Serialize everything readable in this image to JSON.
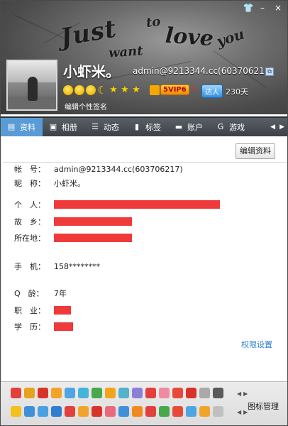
{
  "window": {
    "controls": {
      "skin_icon": "👕",
      "minimize": "–",
      "close": "×"
    }
  },
  "banner": {
    "script_words": [
      "Just",
      "to",
      "love",
      "you",
      "want"
    ]
  },
  "profile": {
    "nickname": "小虾米。",
    "account": "admin@9213344.cc(603706217)",
    "vip_label": "5VIP6",
    "vip_up": "↑",
    "daren_label": "达人",
    "days": "230天",
    "signature": "编辑个性签名",
    "level_icons": [
      "sun-icon",
      "sun-icon",
      "sun-icon",
      "moon-icon",
      "star-icon",
      "star-icon",
      "star-icon"
    ]
  },
  "tabs": [
    {
      "label": "资料",
      "icon": "profile-card-icon",
      "glyph": "▤",
      "active": true
    },
    {
      "label": "相册",
      "icon": "photo-icon",
      "glyph": "▣",
      "active": false
    },
    {
      "label": "动态",
      "icon": "feed-icon",
      "glyph": "☰",
      "active": false
    },
    {
      "label": "标签",
      "icon": "bookmark-icon",
      "glyph": "▮",
      "active": false
    },
    {
      "label": "账户",
      "icon": "wallet-icon",
      "glyph": "▬",
      "active": false
    },
    {
      "label": "游戏",
      "icon": "game-icon",
      "glyph": "G",
      "active": false
    }
  ],
  "tab_arrows": {
    "left": "◀",
    "right": "▶"
  },
  "content": {
    "edit_button": "编辑资料",
    "fields": {
      "account": {
        "label": "帐　号：",
        "value": "admin@9213344.cc(603706217)"
      },
      "nickname": {
        "label": "昵　称：",
        "value": "小虾米。"
      },
      "personal": {
        "label": "个　人："
      },
      "hometown": {
        "label": "故　乡："
      },
      "location": {
        "label": "所在地："
      },
      "phone": {
        "label": "手　机：",
        "value": "158********"
      },
      "qage": {
        "label": "Q　龄：",
        "value": "7年"
      },
      "job": {
        "label": "职　业："
      },
      "education": {
        "label": "学　历："
      }
    },
    "permission_link": "权限设置"
  },
  "bottom": {
    "manage_label": "图标管理",
    "arrows": {
      "left": "◀",
      "right": "▶"
    }
  },
  "colors": {
    "active_tab": "#5a9bd5",
    "redaction": "#f0393b",
    "link": "#2c7fd2"
  }
}
